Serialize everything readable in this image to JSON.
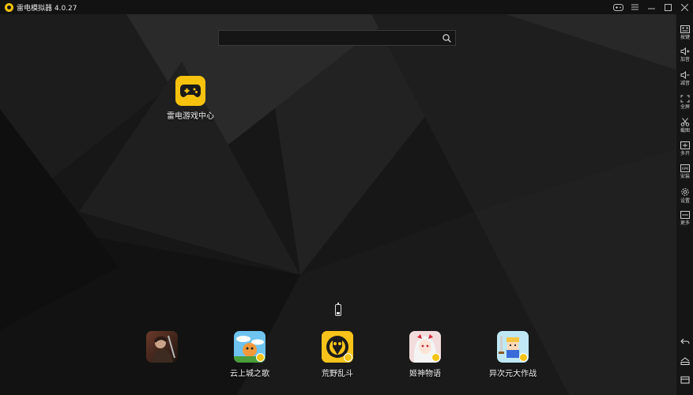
{
  "window": {
    "title": "雷电模拟器 4.0.27",
    "controls": [
      "gamepad-icon",
      "menu-icon",
      "minimize-icon",
      "maximize-icon",
      "close-icon"
    ]
  },
  "search": {
    "value": "",
    "placeholder": ""
  },
  "desktop_apps": [
    {
      "label": "雷电游戏中心",
      "icon": "game-controller-icon",
      "color": "#f6c20e"
    }
  ],
  "dock": [
    {
      "label": "",
      "icon": "warrior-game-icon"
    },
    {
      "label": "云上城之歌",
      "icon": "cloud-city-game-icon"
    },
    {
      "label": "荒野乱斗",
      "icon": "brawl-stars-icon"
    },
    {
      "label": "姬神物语",
      "icon": "anime-girl-game-icon"
    },
    {
      "label": "异次元大作战",
      "icon": "pixel-hero-game-icon"
    }
  ],
  "sidebar": {
    "tools": [
      {
        "label": "按键",
        "icon": "keyboard-icon"
      },
      {
        "label": "加音",
        "icon": "volume-up-icon"
      },
      {
        "label": "减音",
        "icon": "volume-down-icon"
      },
      {
        "label": "全屏",
        "icon": "fullscreen-icon"
      },
      {
        "label": "截图",
        "icon": "scissors-icon"
      },
      {
        "label": "多开",
        "icon": "multi-instance-icon"
      },
      {
        "label": "安装",
        "icon": "apk-install-icon"
      },
      {
        "label": "设置",
        "icon": "settings-gear-icon"
      },
      {
        "label": "更多",
        "icon": "more-icon"
      }
    ],
    "nav": [
      "back-icon",
      "home-icon",
      "recent-apps-icon"
    ]
  },
  "colors": {
    "accent": "#f6c20e",
    "background": "#161616",
    "titlebar": "#121212"
  }
}
